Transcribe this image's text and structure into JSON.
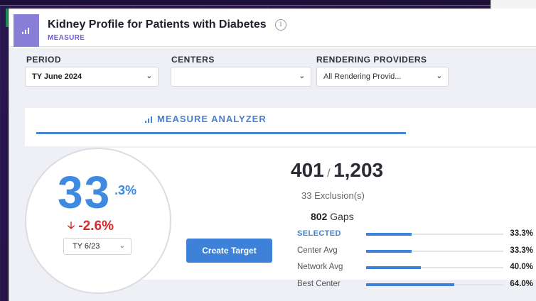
{
  "header": {
    "title": "Kidney Profile for Patients with Diabetes",
    "subtitle": "MEASURE",
    "info_icon": "info-icon"
  },
  "filters": {
    "period": {
      "label": "PERIOD",
      "value": "TY June 2024"
    },
    "centers": {
      "label": "CENTERS",
      "value": ""
    },
    "providers": {
      "label": "RENDERING PROVIDERS",
      "value": "All Rendering Provid..."
    }
  },
  "tabs": {
    "analyzer_label": "MEASURE ANALYZER"
  },
  "score": {
    "integer": "33",
    "decimal": ".3%",
    "delta": "-2.6%",
    "delta_direction": "down",
    "compare_period": "TY 6/23"
  },
  "counts": {
    "numerator": "401",
    "denominator": "1,203",
    "exclusions_count": "33",
    "exclusions_label": "Exclusion(s)",
    "gaps_count": "802",
    "gaps_label": "Gaps"
  },
  "actions": {
    "create_target": "Create Target"
  },
  "benchmarks": [
    {
      "label": "SELECTED",
      "value": "33.3%",
      "fraction": 0.333
    },
    {
      "label": "Center Avg",
      "value": "33.3%",
      "fraction": 0.333
    },
    {
      "label": "Network Avg",
      "value": "40.0%",
      "fraction": 0.4
    },
    {
      "label": "Best Center",
      "value": "64.0%",
      "fraction": 0.64
    }
  ],
  "colors": {
    "accent": "#3d82d8",
    "negative": "#d32a2a",
    "brand_purple": "#6b5fd0"
  }
}
